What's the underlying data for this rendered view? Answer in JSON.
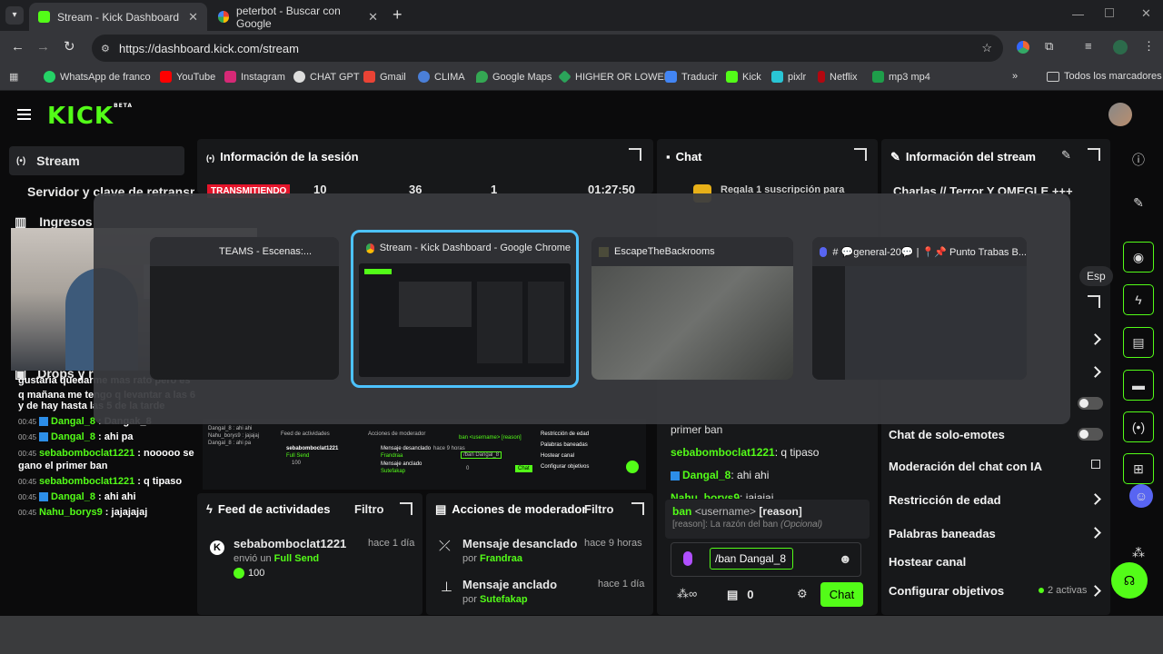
{
  "browser": {
    "tabs": [
      {
        "title": "Stream - Kick Dashboard"
      },
      {
        "title": "peterbot - Buscar con Google"
      }
    ],
    "url": "https://dashboard.kick.com/stream",
    "bookmarks": [
      "WhatsApp de franco",
      "YouTube",
      "Instagram",
      "CHAT GPT",
      "Gmail",
      "CLIMA",
      "Google Maps",
      "HIGHER OR LOWER",
      "Traducir",
      "Kick",
      "pixlr",
      "Netflix",
      "mp3 mp4"
    ],
    "all_bookmarks": "Todos los marcadores"
  },
  "header": {
    "logo": "KICK",
    "logo_badge": "BETA"
  },
  "sidebar": {
    "items": [
      {
        "label": "Stream"
      },
      {
        "label": "Servidor y clave de retransm"
      },
      {
        "label": "Ingresos"
      },
      {
        "label": "Drops y r"
      }
    ]
  },
  "session": {
    "title": "Información de la sesión",
    "live_badge": "TRANSMITIENDO",
    "stats": [
      "10",
      "36",
      "1",
      "01:27:50"
    ]
  },
  "chat": {
    "title": "Chat",
    "gift_text": "Regala 1 suscripción para",
    "messages": [
      {
        "user": "",
        "text": "primer ban"
      },
      {
        "user": "sebabomboclat1221",
        "text": ": q tipaso"
      },
      {
        "user": "Dangal_8",
        "text": ": ahi ahi"
      },
      {
        "user": "Nahu_borys9",
        "text": ": jajajaj"
      }
    ],
    "cmd_name": "ban",
    "cmd_args": "<username>",
    "cmd_opt": "[reason]",
    "cmd_help_label": "[reason]:",
    "cmd_help_text": "La razón del ban",
    "cmd_help_opt": "(Opcional)",
    "input_value": "/ban Dangal_8",
    "points": "0",
    "send_label": "Chat"
  },
  "stream_info": {
    "title": "Información del stream",
    "stream_title": "Charlas // Terror Y OMEGLE +++",
    "lang_chip": "Esp"
  },
  "settings": {
    "rows": [
      {
        "label": "Chat de solo-emotes"
      },
      {
        "label": "Moderación del chat con IA"
      },
      {
        "label": "Restricción de edad"
      },
      {
        "label": "Palabras baneadas"
      },
      {
        "label": "Hostear canal"
      },
      {
        "label": "Configurar objetivos"
      }
    ],
    "goals_active": "2 activas"
  },
  "activity": {
    "title": "Feed de actividades",
    "filter": "Filtro",
    "item_user": "sebabomboclat1221",
    "item_time": "hace 1 día",
    "item_action": "envió un",
    "item_action_highlight": "Full Send",
    "item_amount": "100"
  },
  "mod_actions": {
    "title": "Acciones de moderador",
    "filter": "Filtro",
    "items": [
      {
        "action": "Mensaje desanclado",
        "by_label": "por",
        "by": "Frandraa",
        "time": "hace 9 horas"
      },
      {
        "action": "Mensaje anclado",
        "by_label": "por",
        "by": "Sutefakap",
        "time": "hace 1 día"
      }
    ]
  },
  "overlay_chat": [
    {
      "time": "",
      "user": "",
      "text": "gustaria quedarme mas rato pero es"
    },
    {
      "time": "",
      "user": "",
      "text": "q mañana me tengo q levantar a las 6"
    },
    {
      "time": "",
      "user": "",
      "text": "y de hay hasta las 5 de la tarde"
    },
    {
      "time": "00:45",
      "user": "Dangal_8",
      "text": ": Dangak_8"
    },
    {
      "time": "00:45",
      "user": "Dangal_8",
      "text": ": ahi pa"
    },
    {
      "time": "00:45",
      "user": "sebabomboclat1221",
      "text": ": nooooo se"
    },
    {
      "time": "",
      "user": "",
      "text": "gano el primer ban"
    },
    {
      "time": "00:45",
      "user": "sebabomboclat1221",
      "text": ": q tipaso"
    },
    {
      "time": "00:45",
      "user": "Dangal_8",
      "text": ": ahi ahi"
    },
    {
      "time": "00:45",
      "user": "Nahu_borys9",
      "text": ": jajajajaj"
    }
  ],
  "preview_lines": {
    "feed": "Feed de actividades",
    "mod": "Acciones de moderador",
    "user": "sebabomboclat1221",
    "full_send": "Full Send",
    "amount": "100",
    "unpinned": "Mensaje desanclado",
    "unpinned_by": "Frandraa",
    "unpinned_time": "hace 9 horas",
    "pinned": "Mensaje anclado",
    "pinned_by": "Sutefakap",
    "cmd": "ban <username> [reason]",
    "cmd_input": "/ban Dangal_8",
    "chat_btn": "Chat",
    "points": "0",
    "r1": "Restricción de edad",
    "r2": "Palabras baneadas",
    "r3": "Hostear canal",
    "r4": "Configurar objetivos",
    "chat_a": "Dangal_8 : ahi ahi",
    "chat_b": "Nahu_borys9 : jajajaj",
    "chat_c": "Dangal_8 : ahi pa"
  },
  "switcher": {
    "windows": [
      {
        "title": "TEAMS - Escenas:..."
      },
      {
        "title": "Stream - Kick Dashboard - Google Chrome"
      },
      {
        "title": "EscapeTheBackrooms"
      },
      {
        "title": "# 💬general-20💬 | 📍📌 Punto Trabas B..."
      }
    ]
  },
  "colors": {
    "kick_green": "#53fc18",
    "live_red": "#e5142a",
    "switch_highlight": "#4cc2ff"
  }
}
